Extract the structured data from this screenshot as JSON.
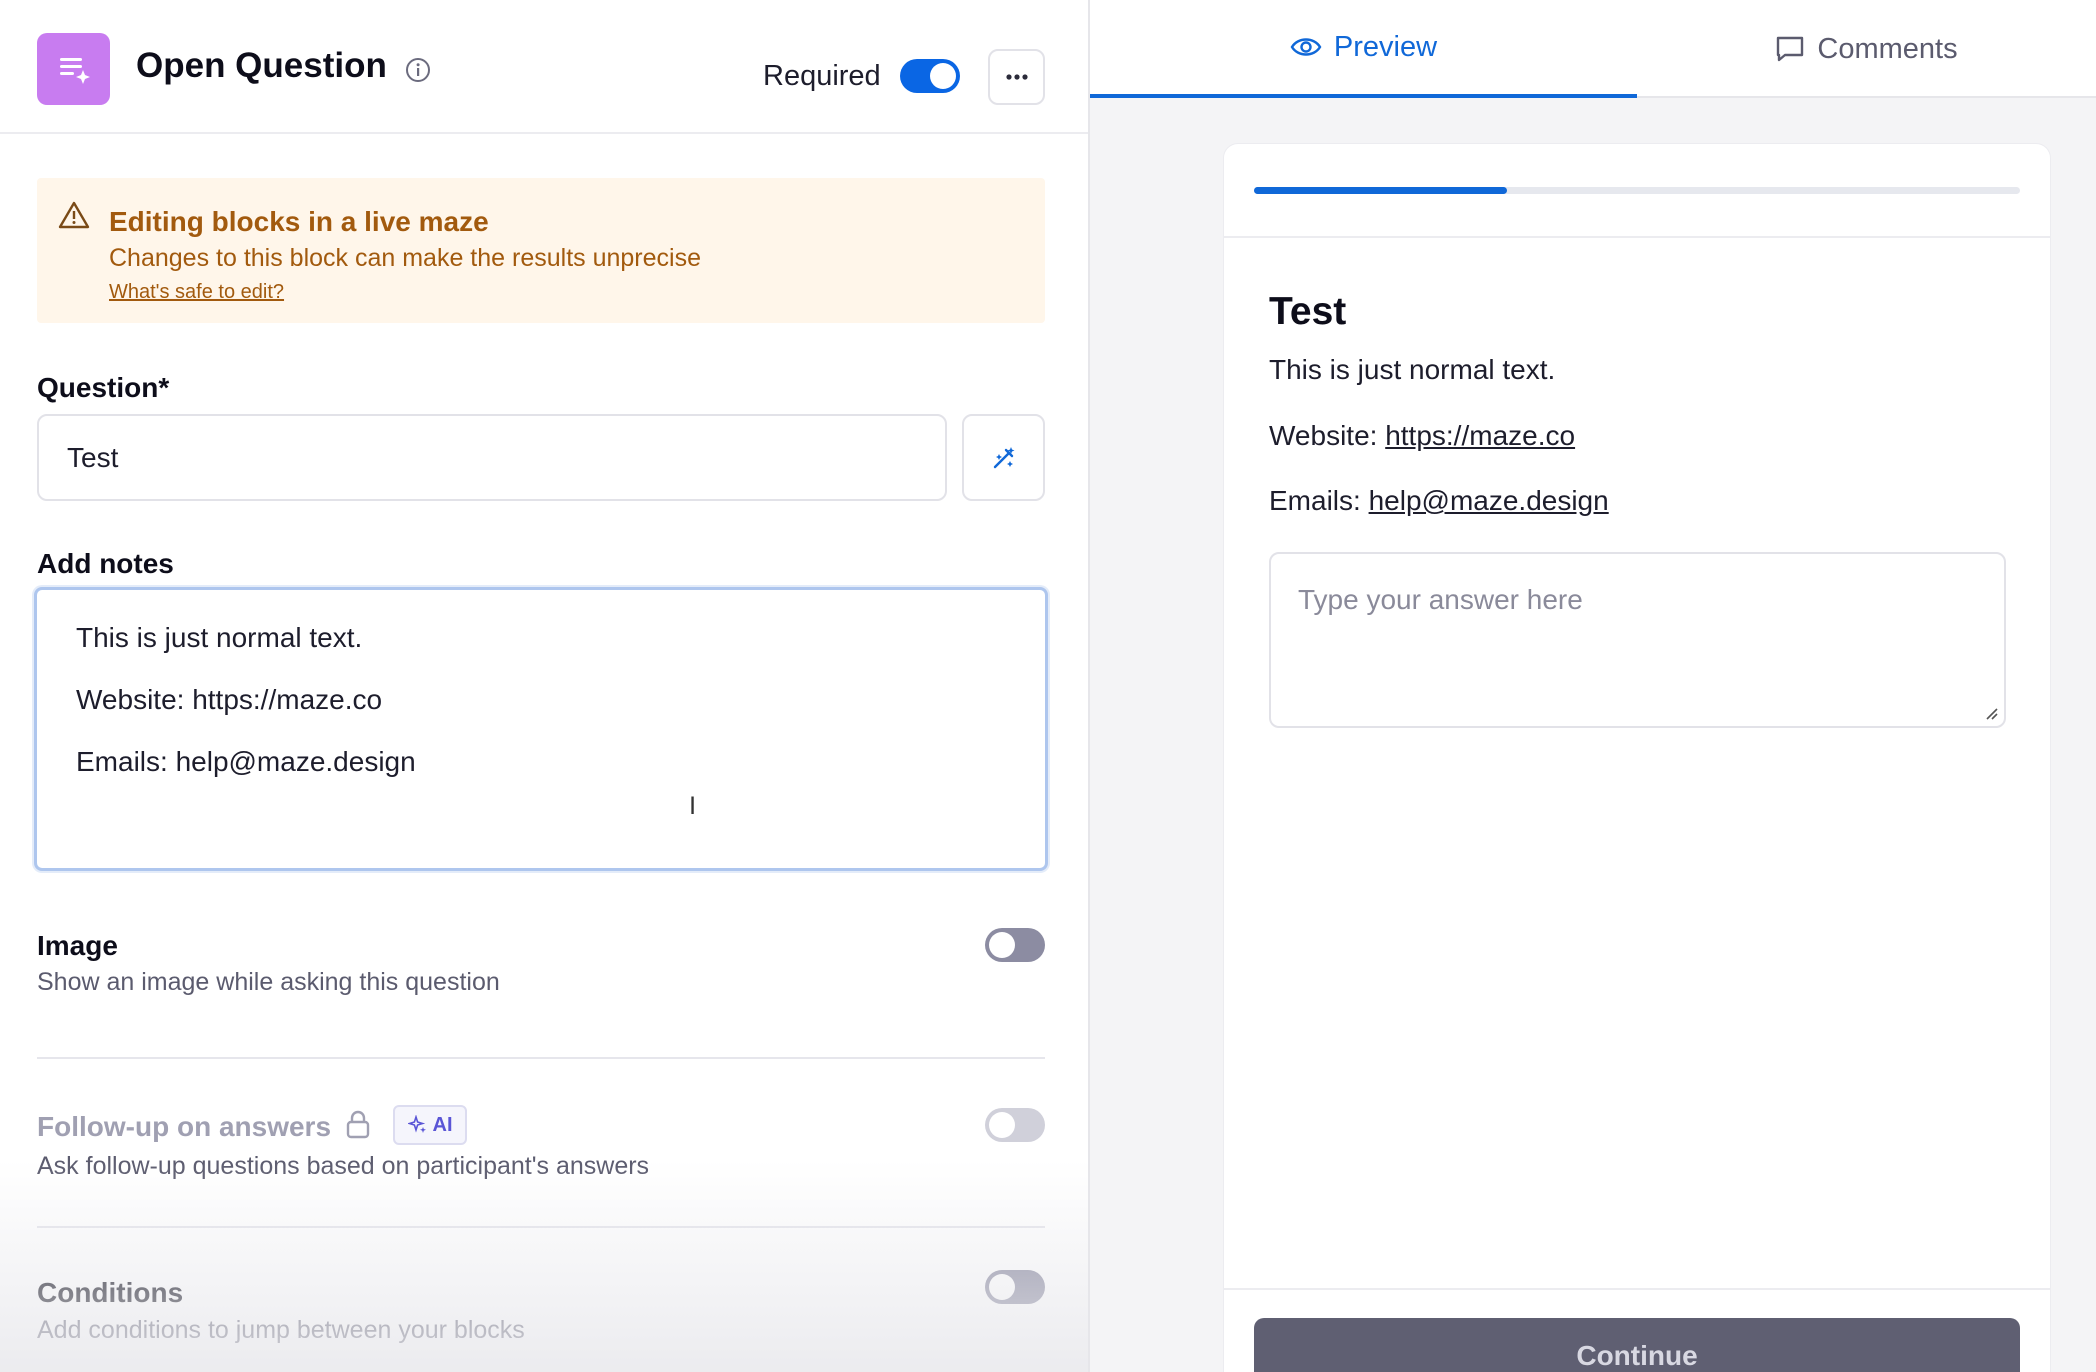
{
  "editor": {
    "block_title": "Open Question",
    "required_label": "Required",
    "required_on": true,
    "warning": {
      "title": "Editing blocks in a live maze",
      "text": "Changes to this block can make the results unprecise",
      "link": "What's safe to edit?"
    },
    "question_label": "Question*",
    "question_value": "Test",
    "notes_label": "Add notes",
    "notes_lines": [
      "This is just normal text.",
      "Website: https://maze.co",
      "Emails: help@maze.design"
    ],
    "options": [
      {
        "title": "Image",
        "desc": "Show an image while asking this question",
        "on": false
      },
      {
        "title": "Follow-up on answers",
        "desc": "Ask follow-up questions based on participant's answers",
        "badge": "AI",
        "locked": true,
        "on": false
      },
      {
        "title": "Conditions",
        "desc": "Add conditions to jump between your blocks",
        "on": false
      }
    ]
  },
  "preview": {
    "tabs": [
      {
        "label": "Preview",
        "icon": "eye-icon",
        "active": true
      },
      {
        "label": "Comments",
        "icon": "comment-icon",
        "active": false
      }
    ],
    "progress": 0.33,
    "title": "Test",
    "text": "This is just normal text.",
    "website_prefix": "Website: ",
    "website_link": "https://maze.co",
    "emails_prefix": "Emails: ",
    "emails_link": "help@maze.design",
    "answer_placeholder": "Type your answer here",
    "continue_label": "Continue"
  },
  "colors": {
    "accent": "#1068d8",
    "block_icon": "#c87cf0",
    "warning_bg": "#fff6ea",
    "warning_text": "#a25a0e",
    "ai_badge": "#5a55d6"
  }
}
